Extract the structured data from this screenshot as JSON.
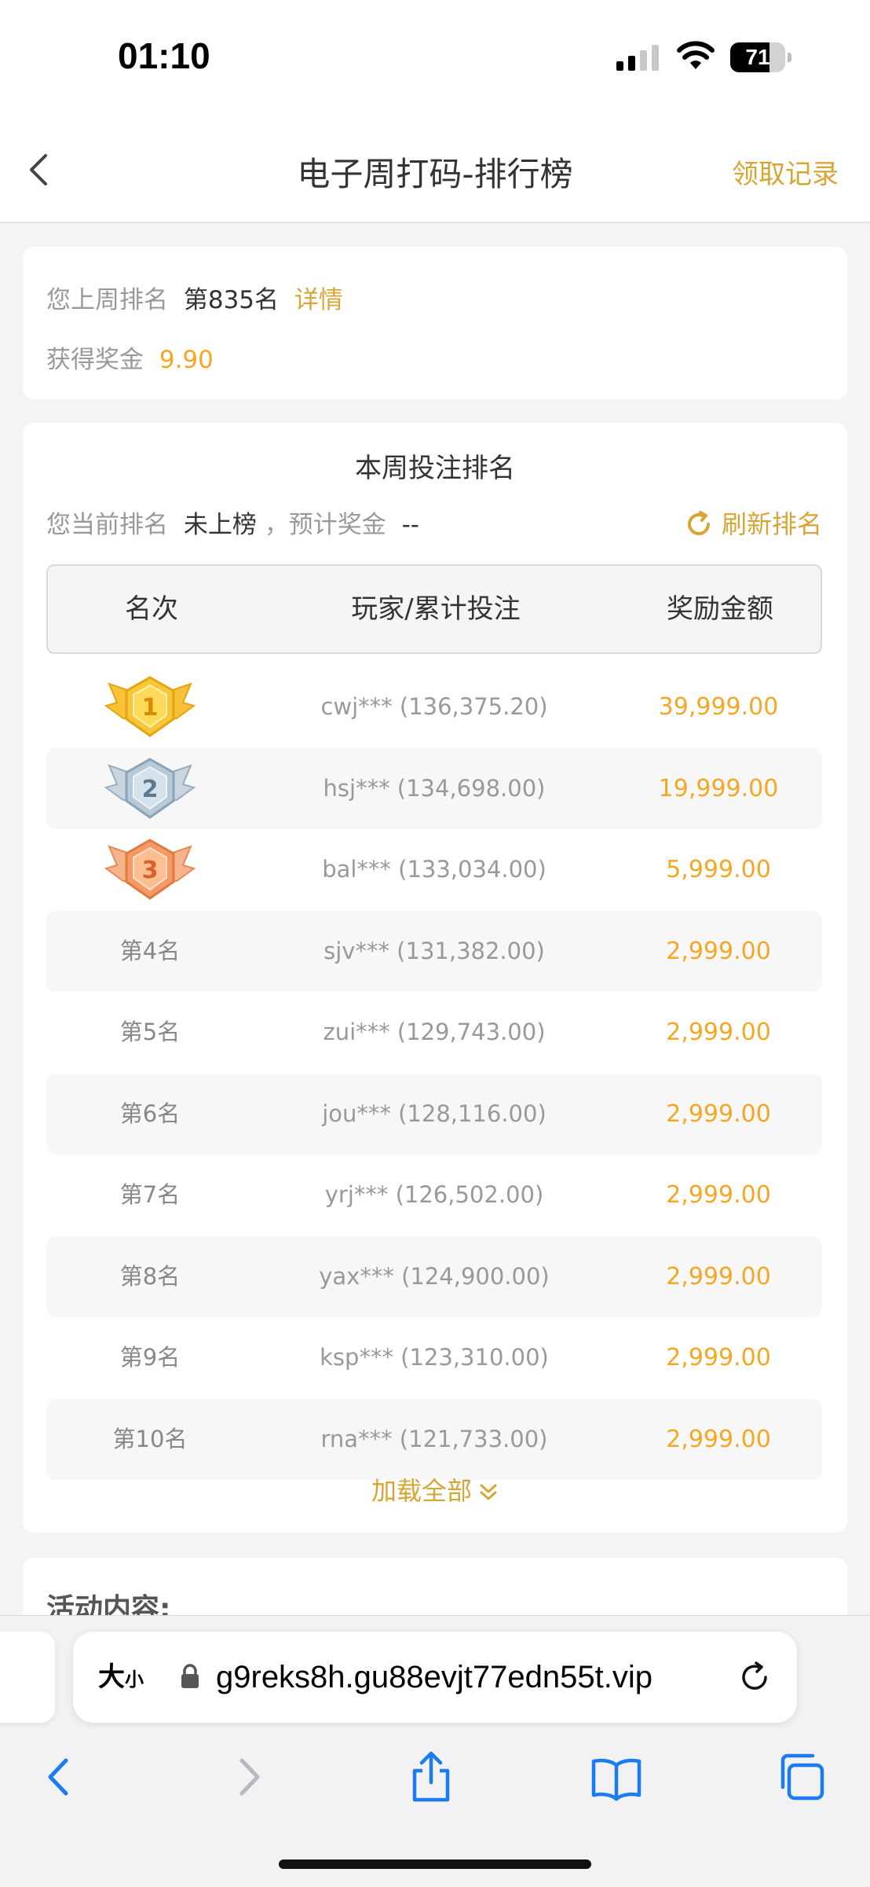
{
  "status_bar": {
    "time": "01:10",
    "battery": "71",
    "battery_level": 0.71
  },
  "nav": {
    "title": "电子周打码-排行榜",
    "right_link": "领取记录"
  },
  "last_week": {
    "rank_label": "您上周排名",
    "rank_value": "第835名",
    "detail_link": "详情",
    "prize_label": "获得奖金",
    "prize_value": "9.90"
  },
  "ranking": {
    "title": "本周投注排名",
    "current_rank_label": "您当前排名",
    "current_rank_value": "未上榜",
    "expected_prize_label": "，预计奖金",
    "expected_prize_value": "--",
    "refresh_label": "刷新排名",
    "columns": [
      "名次",
      "玩家/累计投注",
      "奖励金额"
    ],
    "rows": [
      {
        "rank": "1",
        "player": "cwj*** (136,375.20)",
        "prize": "39,999.00",
        "medal": "gold"
      },
      {
        "rank": "2",
        "player": "hsj*** (134,698.00)",
        "prize": "19,999.00",
        "medal": "silver"
      },
      {
        "rank": "3",
        "player": "bal*** (133,034.00)",
        "prize": "5,999.00",
        "medal": "bronze"
      },
      {
        "rank": "第4名",
        "player": "sjv*** (131,382.00)",
        "prize": "2,999.00"
      },
      {
        "rank": "第5名",
        "player": "zui*** (129,743.00)",
        "prize": "2,999.00"
      },
      {
        "rank": "第6名",
        "player": "jou*** (128,116.00)",
        "prize": "2,999.00"
      },
      {
        "rank": "第7名",
        "player": "yrj*** (126,502.00)",
        "prize": "2,999.00"
      },
      {
        "rank": "第8名",
        "player": "yax*** (124,900.00)",
        "prize": "2,999.00"
      },
      {
        "rank": "第9名",
        "player": "ksp*** (123,310.00)",
        "prize": "2,999.00"
      },
      {
        "rank": "第10名",
        "player": "rna*** (121,733.00)",
        "prize": "2,999.00"
      }
    ],
    "load_all": "加载全部"
  },
  "activity": {
    "title": "活动内容:"
  },
  "browser": {
    "text_size_label": "大",
    "text_size_small": "小",
    "url": "g9reks8h.gu88evjt77edn55t.vip"
  },
  "colors": {
    "gold": "#d7a533",
    "orange": "#f5a623",
    "blue": "#1a7cf0"
  }
}
